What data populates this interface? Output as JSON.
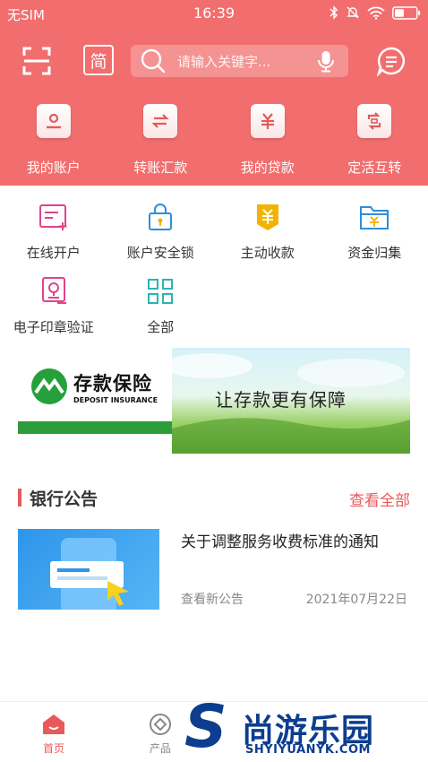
{
  "status_bar": {
    "carrier": "无SIM",
    "time": "16:39",
    "icons": [
      "bluetooth-icon",
      "mute-icon",
      "wifi-icon",
      "battery-icon"
    ]
  },
  "toolbar": {
    "scan_icon": "scan-icon",
    "lang_toggle": "简",
    "search_placeholder": "请输入关键字...",
    "voice_icon": "microphone-icon",
    "message_icon": "message-icon"
  },
  "quick_actions": [
    {
      "label": "我的账户",
      "icon": "account-icon"
    },
    {
      "label": "转账汇款",
      "icon": "transfer-icon"
    },
    {
      "label": "我的贷款",
      "icon": "loan-icon"
    },
    {
      "label": "定活互转",
      "icon": "deposit-convert-icon"
    }
  ],
  "services": [
    {
      "label": "在线开户",
      "icon": "open-account-icon"
    },
    {
      "label": "账户安全锁",
      "icon": "security-lock-icon"
    },
    {
      "label": "主动收款",
      "icon": "receive-payment-icon"
    },
    {
      "label": "资金归集",
      "icon": "fund-collection-icon"
    },
    {
      "label": "电子印章验证",
      "icon": "e-seal-icon"
    },
    {
      "label": "全部",
      "icon": "all-apps-icon"
    }
  ],
  "banner": {
    "title": "存款保险",
    "subtitle": "DEPOSIT INSURANCE",
    "slogan": "让存款更有保障"
  },
  "announcements": {
    "title": "银行公告",
    "view_all": "查看全部",
    "items": [
      {
        "title": "关于调整服务收费标准的通知",
        "subtitle": "查看新公告",
        "date": "2021年07月22日"
      }
    ]
  },
  "tabbar": {
    "tabs": [
      {
        "label": "首页",
        "icon": "home-icon",
        "active": true
      },
      {
        "label": "产品",
        "icon": "product-icon",
        "active": false
      }
    ]
  },
  "watermark": {
    "logo": "S",
    "name": "尚游乐园",
    "site": "SHYIYUANYK.COM"
  },
  "colors": {
    "primary": "#f26e6e",
    "accent_text": "#e85a5a",
    "watermark": "#0c3d8f"
  }
}
